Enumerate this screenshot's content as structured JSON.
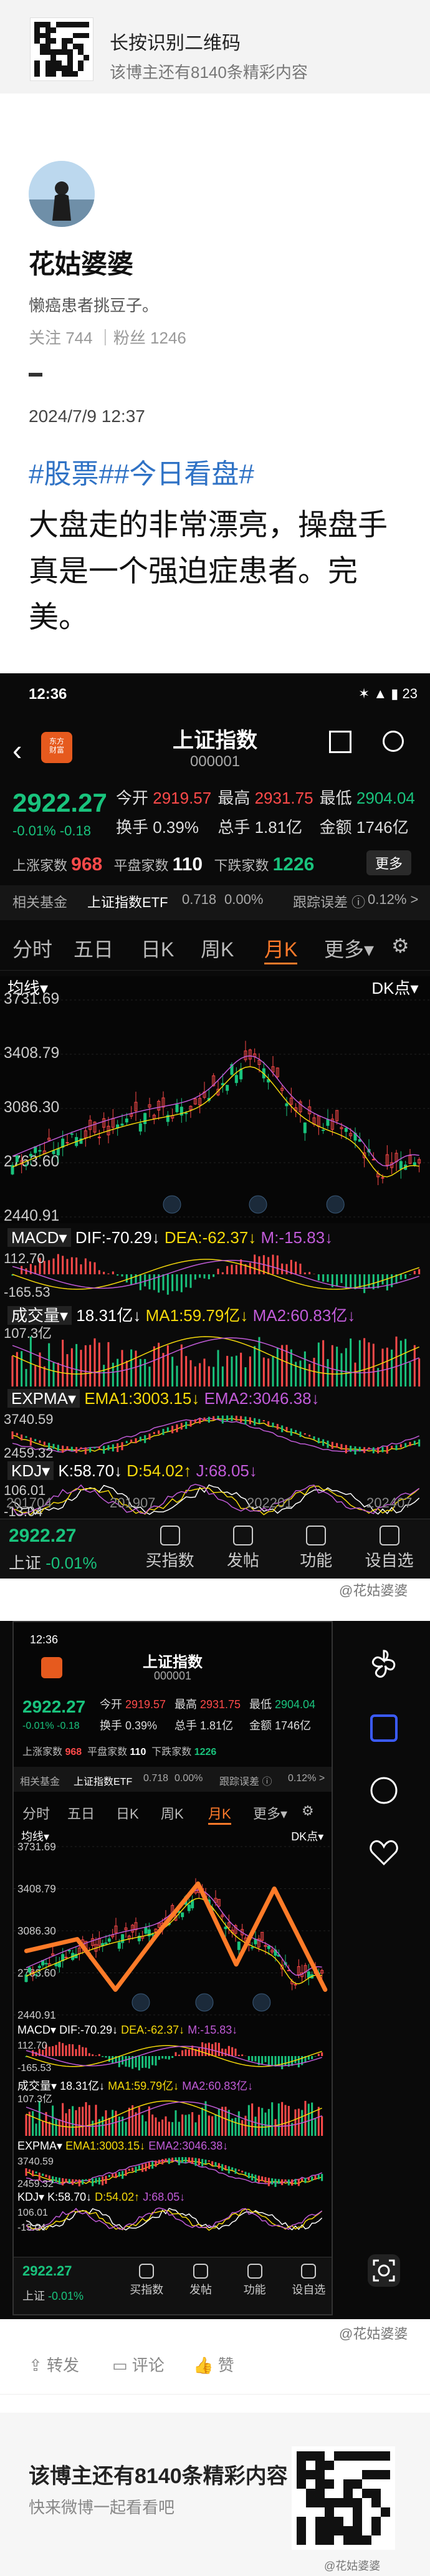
{
  "banner": {
    "title": "长按识别二维码",
    "subtitle": "该博主还有8140条精彩内容"
  },
  "author": {
    "name": "花姑婆婆",
    "bio": "懒癌患者挑豆子。",
    "stats": "关注 744 ｜粉丝 1246"
  },
  "post": {
    "date": "2024/7/9 12:37",
    "tags": "#股票##今日看盘#",
    "text": "大盘走的非常漂亮，操盘手真是一个强迫症患者。完美。"
  },
  "app": {
    "status_time": "12:36",
    "status_icons": "✶ ▲ ▮ 23",
    "logo": "东方\n财富",
    "stock_name": "上证指数",
    "stock_code": "000001",
    "price": "2922.27",
    "change": "-0.01%  -0.18",
    "quotes": [
      {
        "label": "今开",
        "value": "2919.57",
        "color": "#ff4a4a"
      },
      {
        "label": "最高",
        "value": "2931.75",
        "color": "#ff4a4a"
      },
      {
        "label": "最低",
        "value": "2904.04",
        "color": "#19c37d"
      },
      {
        "label": "换手",
        "value": "0.39%",
        "color": "#dddddd"
      },
      {
        "label": "总手",
        "value": "1.81亿",
        "color": "#dddddd"
      },
      {
        "label": "金额",
        "value": "1746亿",
        "color": "#dddddd"
      }
    ],
    "up_label": "上涨家数",
    "up": "968",
    "flat_label": "平盘家数",
    "flat": "110",
    "down_label": "下跌家数",
    "down": "1226",
    "more": "更多",
    "related": [
      "相关基金",
      "上证指数ETF",
      "0.718",
      "0.00%",
      "跟踪误差 ⓘ",
      "0.12% >"
    ],
    "period_tabs": [
      "分时",
      "五日",
      "日K",
      "周K",
      "月K",
      "更多▾",
      "⚙"
    ],
    "chart_header": {
      "left": "均线▾",
      "right": "DK点▾"
    },
    "y_labels": [
      "3731.69",
      "3408.79",
      "3086.30",
      "2763.60",
      "2440.91"
    ],
    "macd": {
      "label": "MACD▾",
      "dif": "DIF:-70.29↓",
      "dea": "DEA:-62.37↓",
      "m": "M:-15.83↓",
      "ticks": [
        "112.70",
        "-165.53"
      ]
    },
    "volume": {
      "label": "成交量▾",
      "v": "18.31亿↓",
      "ma1": "MA1:59.79亿↓",
      "ma2": "MA2:60.83亿↓",
      "ticks": [
        "107.3亿"
      ]
    },
    "expma": {
      "label": "EXPMA▾",
      "e1": "EMA1:3003.15↓",
      "e2": "EMA2:3046.38↓",
      "ticks": [
        "3740.59",
        "2459.32"
      ]
    },
    "kdj": {
      "label": "KDJ▾",
      "k": "K:58.70↓",
      "d": "D:54.02↑",
      "j": "J:68.05↓",
      "ticks": [
        "106.01",
        "-13.04"
      ]
    },
    "x_labels": [
      "201704",
      "201907",
      "202201",
      "202407"
    ],
    "nav": [
      {
        "label": "上证",
        "icon": "index-icon"
      },
      {
        "label": "买指数",
        "icon": "chart-icon"
      },
      {
        "label": "发帖",
        "icon": "edit-icon"
      },
      {
        "label": "功能",
        "icon": "grid-icon"
      },
      {
        "label": "设自选",
        "icon": "plus-circle-icon"
      }
    ],
    "nav_price": "2922.27",
    "nav_chg": "-0.01%"
  },
  "watermark": "@花姑婆婆",
  "footer": {
    "repost": "转发",
    "comment": "评论",
    "like": "赞"
  },
  "bottom": {
    "title": "该博主还有8140条精彩内容",
    "sub": "快来微博一起看看吧"
  },
  "colors": {
    "up": "#ff4a4a",
    "down": "#19c37d",
    "tag": "#2f72c5",
    "accent": "#ff7a2a"
  }
}
